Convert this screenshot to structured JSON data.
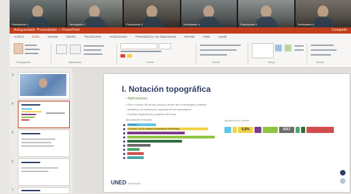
{
  "meeting": {
    "participants": [
      {
        "name": "Participante 1"
      },
      {
        "name": "Participante 2"
      },
      {
        "name": "Participante 3"
      },
      {
        "name": "Participante 4"
      },
      {
        "name": "Participante 5"
      },
      {
        "name": "Participante 6"
      }
    ]
  },
  "app": {
    "left_label": "Autoguardado",
    "title": "Presentación — PowerPoint",
    "right_label": "Compartir"
  },
  "ribbon": {
    "tabs": [
      "Archivo",
      "Inicio",
      "Insertar",
      "Diseño",
      "Transiciones",
      "Animaciones",
      "Presentación con diapositivas",
      "Revisar",
      "Vista",
      "Ayuda"
    ],
    "active_tab": 1,
    "group_labels": [
      "Portapapeles",
      "Diapositivas",
      "Fuente",
      "Párrafo",
      "Dibujo",
      "Edición"
    ]
  },
  "thumbnails": [
    {
      "num": "3"
    },
    {
      "num": "4"
    },
    {
      "num": "5"
    },
    {
      "num": "6"
    },
    {
      "num": "7"
    }
  ],
  "slide": {
    "title": "I. Notación topográfica",
    "subtitle": "• Aplicaciones:",
    "lines": [
      "• Este a veces útil de las posicion dentro de la estrategia y análisis",
      "• Identificar la localización espacial de los marcadores",
      "• Facilitar seguimiento y análisis del tema"
    ],
    "list_label": "Marcadores textuales",
    "bars": [
      {
        "text": "Lexema 1",
        "color": "#5fc6e8"
      },
      {
        "text": "Lexema 2 de la categoría gramatical identificada",
        "color": "#f0d24a"
      },
      {
        "text": "",
        "color": "#7d3b8c"
      },
      {
        "text": "",
        "color": "#8fc441"
      },
      {
        "text": "",
        "color": "#2f6e3c"
      },
      {
        "text": "",
        "color": "#6b6b6b"
      },
      {
        "text": "",
        "color": "#4ca86a"
      },
      {
        "text": "",
        "color": "#d14d4d"
      },
      {
        "text": "",
        "color": "#4aa7a2"
      }
    ],
    "right_caption": "Agrupación por colores",
    "tokens": [
      {
        "text": "",
        "color": "#5fc6e8"
      },
      {
        "text": "",
        "color": "#f0d24a"
      },
      {
        "text": "5,6%",
        "color": "#f0d24a"
      },
      {
        "text": "",
        "color": "#7d3b8c"
      },
      {
        "text": "",
        "color": "#8fc441"
      },
      {
        "text": "2017",
        "color": "#6b6b6b"
      },
      {
        "text": "",
        "color": "#4ca86a"
      },
      {
        "text": "",
        "color": "#2f6e3c"
      },
      {
        "text": "",
        "color": "#d14d4d"
      }
    ],
    "logo_text": "UNED",
    "logo_sub": "Universidad"
  }
}
